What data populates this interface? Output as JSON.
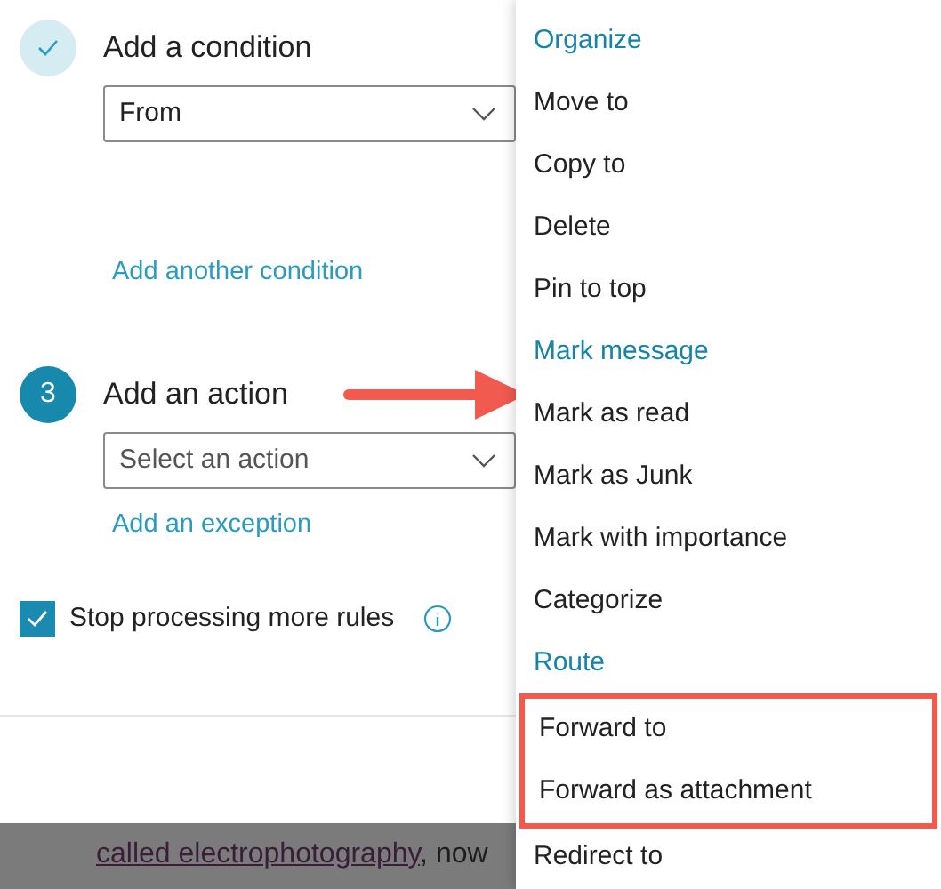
{
  "condition_step": {
    "completed": true,
    "title": "Add a condition",
    "dropdown": {
      "value": "From"
    },
    "link": "Add another condition"
  },
  "action_step": {
    "completed": false,
    "number": "3",
    "title": "Add an action",
    "dropdown": {
      "placeholder": "Select an action"
    },
    "link": "Add an exception"
  },
  "stop_processing": {
    "label": "Stop processing more rules",
    "checked": true
  },
  "document": {
    "lines": [
      {
        "link": "called electrophotography",
        "text": ", now"
      }
    ]
  },
  "menu": {
    "items": [
      {
        "kind": "header",
        "label": "Organize",
        "highlighted": false
      },
      {
        "kind": "option",
        "label": "Move to",
        "highlighted": false
      },
      {
        "kind": "option",
        "label": "Copy to",
        "highlighted": false
      },
      {
        "kind": "option",
        "label": "Delete",
        "highlighted": false
      },
      {
        "kind": "option",
        "label": "Pin to top",
        "highlighted": false
      },
      {
        "kind": "header",
        "label": "Mark message",
        "highlighted": false
      },
      {
        "kind": "option",
        "label": "Mark as read",
        "highlighted": false
      },
      {
        "kind": "option",
        "label": "Mark as Junk",
        "highlighted": false
      },
      {
        "kind": "option",
        "label": "Mark with importance",
        "highlighted": false
      },
      {
        "kind": "option",
        "label": "Categorize",
        "highlighted": false
      },
      {
        "kind": "header",
        "label": "Route",
        "highlighted": false
      },
      {
        "kind": "option",
        "label": "Forward to",
        "highlighted": true
      },
      {
        "kind": "option",
        "label": "Forward as attachment",
        "highlighted": true
      },
      {
        "kind": "option",
        "label": "Redirect to",
        "highlighted": false
      }
    ]
  }
}
